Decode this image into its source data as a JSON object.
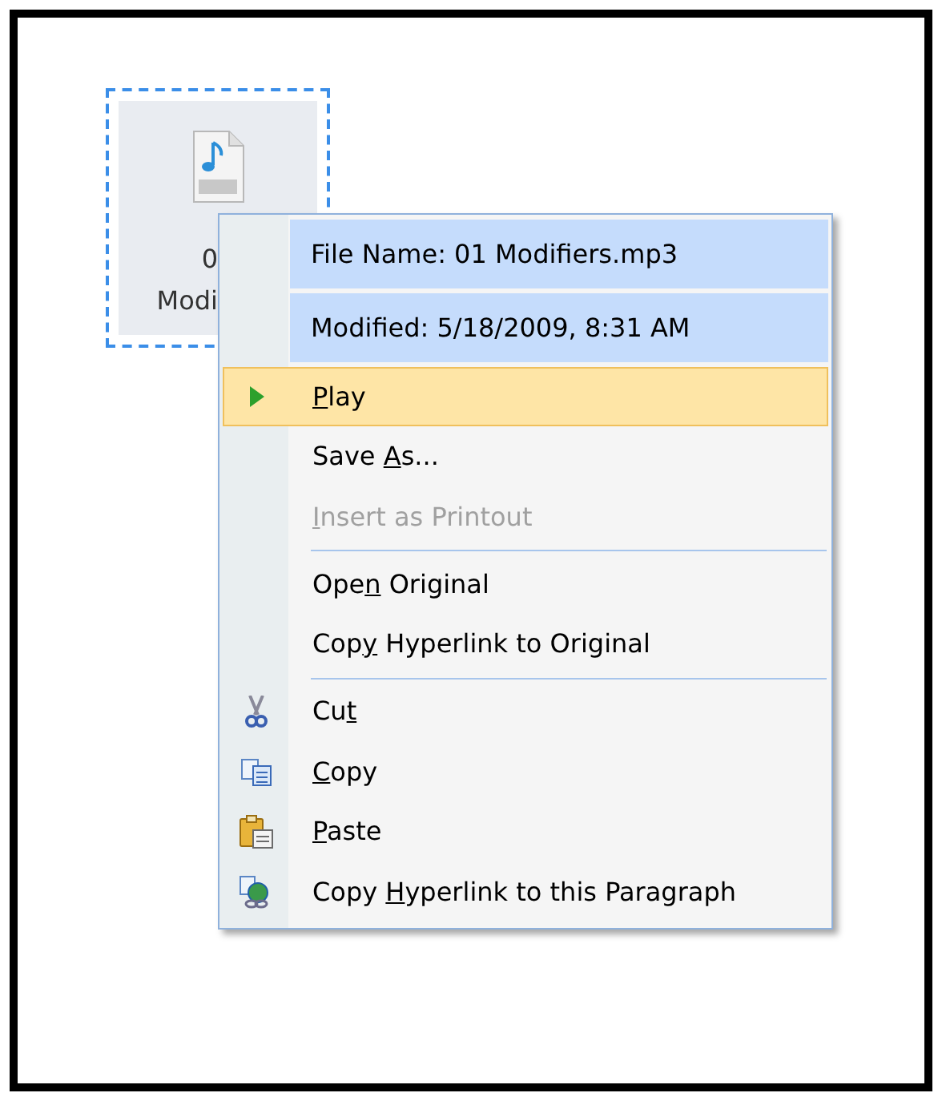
{
  "file_tile": {
    "label_lines": [
      "0",
      "Modi"
    ],
    "selected": true
  },
  "context_menu": {
    "items": [
      {
        "kind": "header",
        "label": {
          "pre": "File Name: 01 Modifiers.mp3"
        }
      },
      {
        "kind": "header",
        "label": {
          "pre": "Modified: 5/18/2009, 8:31 AM"
        }
      },
      {
        "kind": "play",
        "label": {
          "key": "P",
          "post": "lay"
        },
        "selected": true,
        "disabled": false
      },
      {
        "kind": "command",
        "label": {
          "pre": "Save ",
          "key": "A",
          "post": "s..."
        },
        "selected": false,
        "disabled": false
      },
      {
        "kind": "command",
        "label": {
          "key": "I",
          "post": "nsert as Printout"
        },
        "selected": false,
        "disabled": true
      },
      {
        "kind": "separator"
      },
      {
        "kind": "command",
        "label": {
          "pre": "Ope",
          "key": "n",
          "post": " Original"
        },
        "selected": false,
        "disabled": false
      },
      {
        "kind": "command",
        "label": {
          "pre": "Cop",
          "key": "y",
          "post": " Hyperlink to Original"
        },
        "selected": false,
        "disabled": false
      },
      {
        "kind": "separator"
      },
      {
        "kind": "cut",
        "label": {
          "pre": "Cu",
          "key": "t"
        },
        "selected": false,
        "disabled": false
      },
      {
        "kind": "copy",
        "label": {
          "key": "C",
          "post": "opy"
        },
        "selected": false,
        "disabled": false
      },
      {
        "kind": "paste",
        "label": {
          "key": "P",
          "post": "aste"
        },
        "selected": false,
        "disabled": false
      },
      {
        "kind": "link",
        "label": {
          "pre": "Copy ",
          "key": "H",
          "post": "yperlink to this Paragraph"
        },
        "selected": false,
        "disabled": false
      }
    ]
  }
}
